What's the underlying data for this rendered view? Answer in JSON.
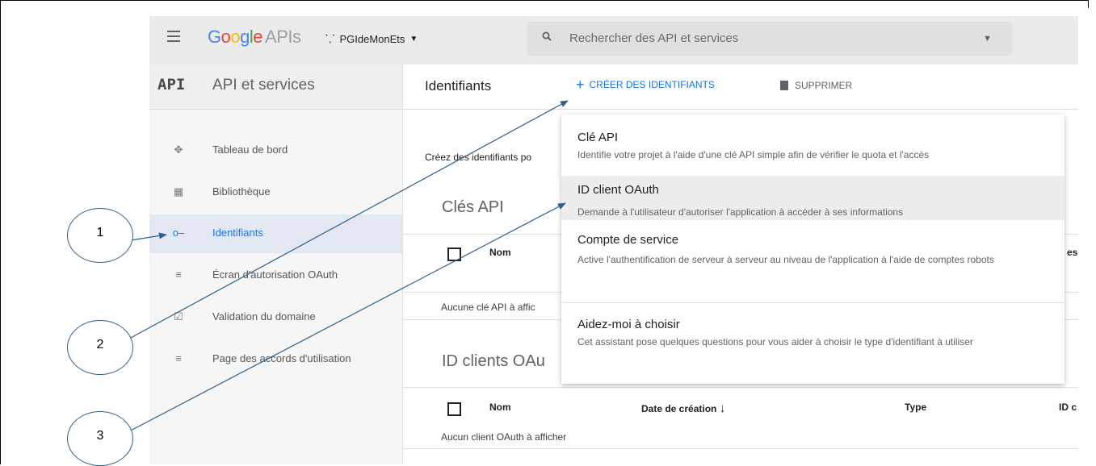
{
  "topbar": {
    "logo_google": "Google",
    "logo_apis": "APIs",
    "project_name": "PGIdeMonEts",
    "search_placeholder": "Rechercher des API et services"
  },
  "sidebar": {
    "api_badge": "API",
    "title": "API et services",
    "items": [
      {
        "label": "Tableau de bord",
        "icon": "dashboard-icon"
      },
      {
        "label": "Bibliothèque",
        "icon": "library-icon"
      },
      {
        "label": "Identifiants",
        "icon": "key-icon",
        "active": true
      },
      {
        "label": "Écran d'autorisation OAuth",
        "icon": "consent-screen-icon"
      },
      {
        "label": "Validation du domaine",
        "icon": "domain-verification-icon"
      },
      {
        "label": "Page des accords d'utilisation",
        "icon": "agreements-icon"
      }
    ]
  },
  "main": {
    "title": "Identifiants",
    "create_label": "CRÉER DES IDENTIFIANTS",
    "delete_label": "SUPPRIMER",
    "intro": "Créez des identifiants po",
    "api_keys": {
      "title": "Clés API",
      "col_name": "Nom",
      "col_partial": "es",
      "empty": "Aucune clé API à affic"
    },
    "oauth": {
      "title": "ID clients OAu",
      "col_name": "Nom",
      "col_date": "Date de création",
      "col_type": "Type",
      "col_id": "ID c",
      "empty": "Aucun client OAuth à afficher"
    }
  },
  "menu": {
    "items": [
      {
        "title": "Clé API",
        "desc": "Identifie votre projet à l'aide d'une clé API simple afin de vérifier le quota et l'accès"
      },
      {
        "title": "ID client OAuth",
        "desc": "Demande à l'utilisateur d'autoriser l'application à accéder à ses informations"
      },
      {
        "title": "Compte de service",
        "desc": "Active l'authentification de serveur à serveur au niveau de l'application à l'aide de comptes robots"
      },
      {
        "title": "Aidez-moi à choisir",
        "desc": "Cet assistant pose quelques questions pour vous aider à choisir le type d'identifiant à utiliser"
      }
    ]
  },
  "callouts": [
    "1",
    "2",
    "3"
  ],
  "colors": {
    "accent": "#1a73e8",
    "callout_line": "#2e5f8a"
  }
}
